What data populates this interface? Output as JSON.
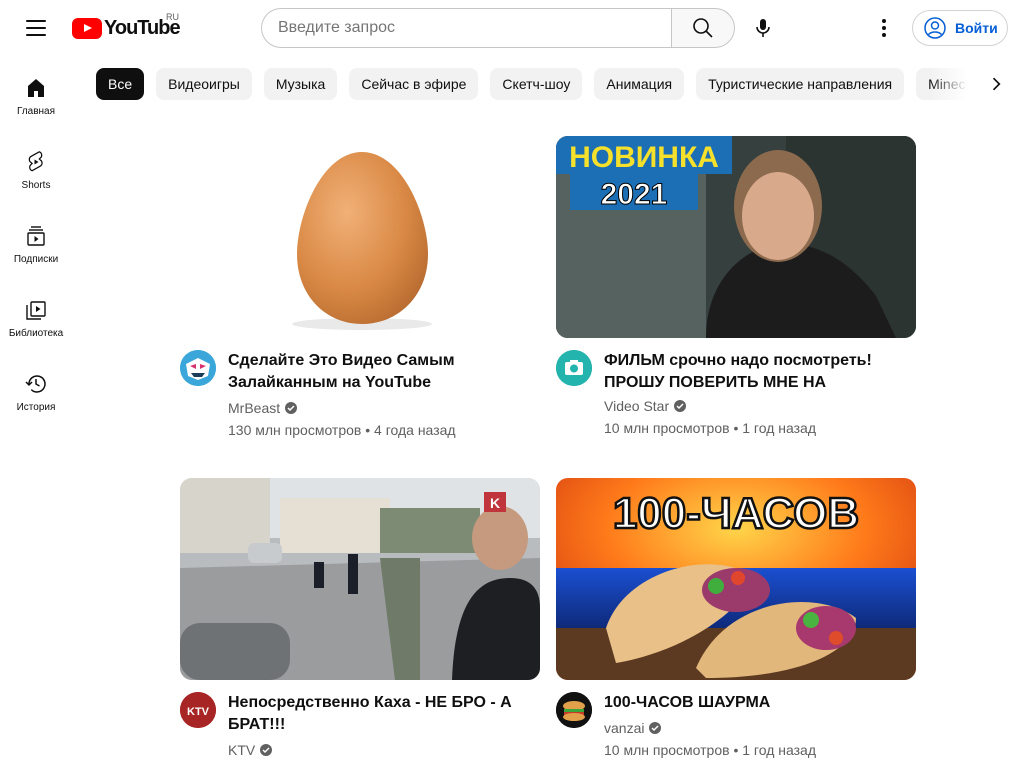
{
  "header": {
    "logo_text": "YouTube",
    "region": "RU",
    "search_placeholder": "Введите запрос",
    "signin_label": "Войти"
  },
  "sidebar": {
    "items": [
      {
        "label": "Главная",
        "icon": "home-icon"
      },
      {
        "label": "Shorts",
        "icon": "shorts-icon"
      },
      {
        "label": "Подписки",
        "icon": "subscriptions-icon"
      },
      {
        "label": "Библиотека",
        "icon": "library-icon"
      },
      {
        "label": "История",
        "icon": "history-icon"
      }
    ]
  },
  "chips": [
    "Все",
    "Видеоигры",
    "Музыка",
    "Сейчас в эфире",
    "Скетч-шоу",
    "Анимация",
    "Туристические направления",
    "Minecraft"
  ],
  "videos": [
    {
      "title": "Сделайте Это Видео Самым Залайканным на YouTube",
      "channel": "MrBeast",
      "verified": true,
      "views": "130 млн просмотров",
      "age": "4 года назад"
    },
    {
      "title": "ФИЛЬМ срочно надо посмотреть! ПРОШУ ПОВЕРИТЬ МНЕ НА СЛОВО…",
      "channel": "Video Star",
      "verified": true,
      "views": "10 млн просмотров",
      "age": "1 год назад",
      "thumb_text_1": "НОВИНКА",
      "thumb_text_2": "2021"
    },
    {
      "title": "Непосредственно Каха - НЕ БРО - А БРАТ!!!",
      "channel": "KTV",
      "verified": true,
      "views": "",
      "age": "",
      "avatar_text": "KTV",
      "thumb_badge": "K"
    },
    {
      "title": "100-ЧАСОВ ШАУРМА",
      "channel": "vanzai",
      "verified": true,
      "views": "10 млн просмотров",
      "age": "1 год назад",
      "thumb_text": "100-ЧАСОВ"
    }
  ],
  "colors": {
    "brand": "#ff0000",
    "link": "#065fd4",
    "secondary_text": "#606060"
  }
}
